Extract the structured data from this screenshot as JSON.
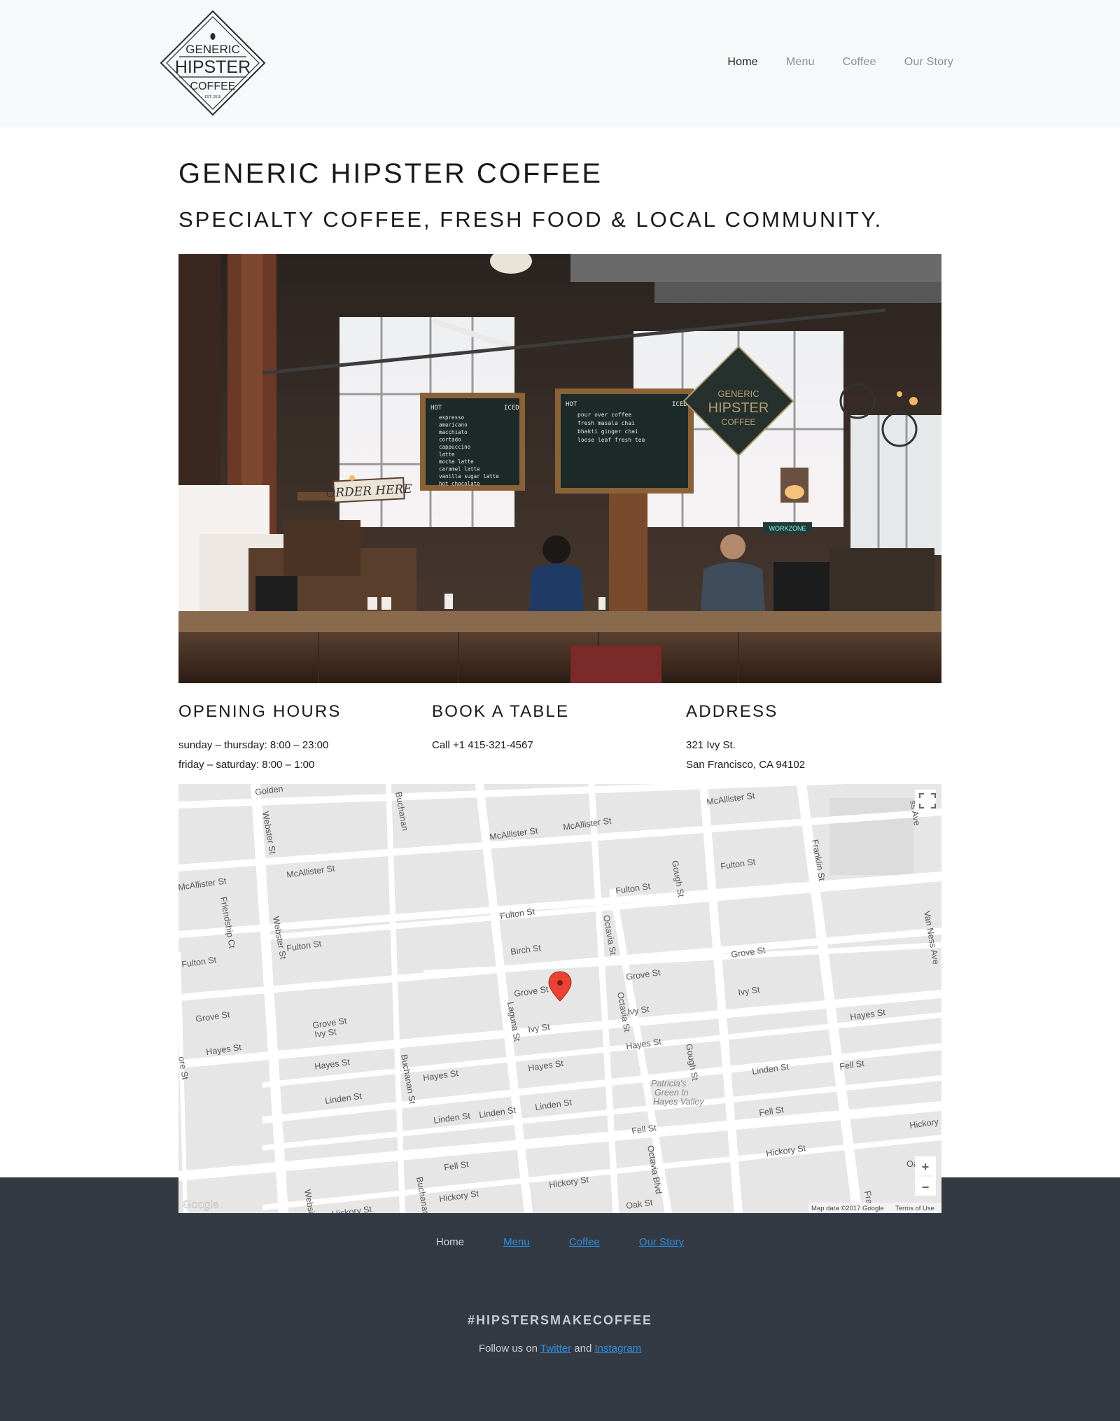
{
  "header": {
    "logo": {
      "line1": "GENERIC",
      "line2": "HIPSTER",
      "line3": "COFFEE",
      "est": "EST. 2015"
    },
    "nav": [
      {
        "label": "Home",
        "active": true
      },
      {
        "label": "Menu",
        "active": false
      },
      {
        "label": "Coffee",
        "active": false
      },
      {
        "label": "Our Story",
        "active": false
      }
    ]
  },
  "main": {
    "title": "GENERIC HIPSTER COFFEE",
    "subtitle": "SPECIALTY COFFEE, FRESH FOOD & LOCAL COMMUNITY.",
    "hero": {
      "sign": "ORDER HERE",
      "board1_title": "HOT",
      "board1_col": "ICED",
      "board1_items": [
        "espresso",
        "americano",
        "macchiato",
        "cortado",
        "cappuccino",
        "latte",
        "mocha latte",
        "caramel latte",
        "vanilla sugar latte",
        "hot chocolate"
      ],
      "board2_title": "HOT",
      "board2_col": "ICED",
      "board2_items": [
        "pour over coffee",
        "fresh masala chai",
        "bhakti ginger chai",
        "loose leaf fresh tea"
      ],
      "work_sign": "WORKZONE"
    },
    "info": {
      "hours": {
        "heading": "OPENING HOURS",
        "line1": "sunday – thursday: 8:00 – 23:00",
        "line2": "friday – saturday: 8:00 – 1:00"
      },
      "book": {
        "heading": "BOOK A TABLE",
        "line1": "Call +1 415-321-4567"
      },
      "address": {
        "heading": "ADDRESS",
        "line1": "321 Ivy St.",
        "line2": "San Francisco, CA 94102"
      }
    },
    "map": {
      "attribution": "Map data ©2017 Google",
      "terms": "Terms of Use",
      "google": "Google",
      "zoom_in": "+",
      "zoom_out": "−",
      "labels": [
        "Golden",
        "McAllister St",
        "McAllister St",
        "McAllister St",
        "McAllister St",
        "McAllister St",
        "Fulton St",
        "Fulton St",
        "Fulton St",
        "Fulton St",
        "Fulton St",
        "Grove St",
        "Grove St",
        "Grove St",
        "Grove St",
        "Grove St",
        "Hayes St",
        "Hayes St",
        "Hayes St",
        "Hayes St",
        "Hayes St",
        "Hayes St",
        "Ivy St",
        "Ivy St",
        "Ivy St",
        "Ivy St",
        "Linden St",
        "Linden St",
        "Linden St",
        "Linden St",
        "Linden St",
        "Fell St",
        "Fell St",
        "Fell St",
        "Fell St",
        "Hickory St",
        "Hickory St",
        "Hickory St",
        "Hickory St",
        "Hickory",
        "Oak St",
        "Birch St",
        "Webster St",
        "Webster St",
        "Websi",
        "Buchanan",
        "Buchanan St",
        "Buchanan",
        "Laguna St",
        "Octavia St",
        "Octavia St",
        "Octavia Blvd",
        "Gough St",
        "Gough St",
        "Franklin St",
        "Fran",
        "Van Ness Ave",
        "ss Ave",
        "Friendship Ct",
        "Patricia's",
        "Green In",
        "Hayes Valley",
        "Oa",
        "ore St"
      ]
    }
  },
  "footer": {
    "nav": [
      {
        "label": "Home"
      },
      {
        "label": "Menu"
      },
      {
        "label": "Coffee"
      },
      {
        "label": "Our Story"
      }
    ],
    "hashtag": "#HIPSTERSMAKECOFFEE",
    "follow_prefix": "Follow us on ",
    "twitter": "Twitter",
    "follow_and": " and ",
    "instagram": "Instagram"
  },
  "colors": {
    "header_bg": "#f7f8f9",
    "footer_bg": "#343a44",
    "link": "#2b8fe0",
    "pin": "#ea4335"
  }
}
